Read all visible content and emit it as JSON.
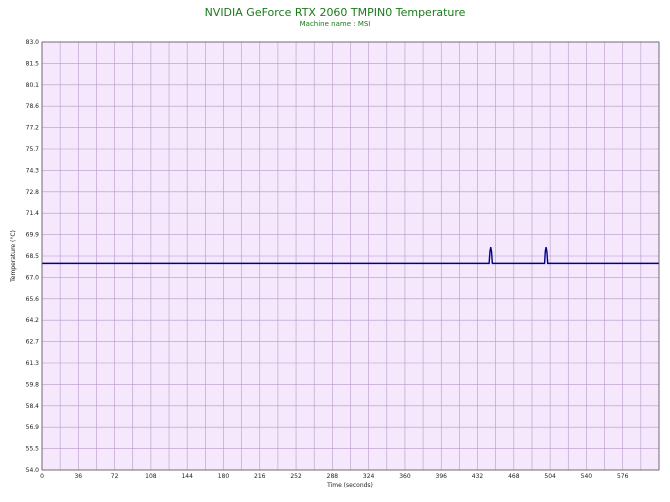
{
  "chart_data": {
    "type": "line",
    "title": "NVIDIA GeForce RTX 2060 TMPIN0 Temperature",
    "subtitle": "Machine name : MSI",
    "xlabel": "Time (seconds)",
    "ylabel": "Temperature (°C)",
    "xlim": [
      0,
      612
    ],
    "ylim": [
      54.0,
      83.0
    ],
    "x_ticks": [
      "0",
      "36",
      "72",
      "108",
      "144",
      "180",
      "216",
      "252",
      "288",
      "324",
      "360",
      "396",
      "432",
      "468",
      "504",
      "540",
      "576"
    ],
    "y_ticks": [
      "83.0",
      "81.5",
      "80.1",
      "78.6",
      "77.2",
      "75.7",
      "74.3",
      "72.8",
      "71.4",
      "69.9",
      "68.5",
      "67.0",
      "65.6",
      "64.2",
      "62.7",
      "61.3",
      "59.8",
      "58.4",
      "56.9",
      "55.5",
      "54.0"
    ],
    "grid": true,
    "colors": {
      "plot_bg": "#f5e8fc",
      "grid": "#b898c8",
      "line": "#00008b",
      "title": "#1a7a1a"
    },
    "series": [
      {
        "x": [
          0,
          443.5,
          444.3,
          445.1,
          445.9,
          446.7,
          498.5,
          499.2,
          500.0,
          500.8,
          501.6,
          612
        ],
        "values": [
          68.0,
          68.0,
          68.8,
          69.1,
          68.8,
          68.0,
          68.0,
          68.8,
          69.1,
          68.8,
          68.0,
          68.0
        ]
      }
    ]
  }
}
